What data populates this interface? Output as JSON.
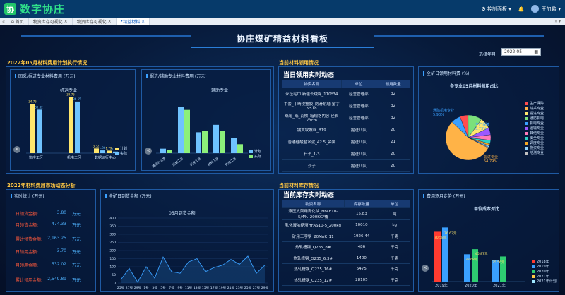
{
  "app": {
    "title": "数字协庄",
    "logo_glyph": "协",
    "control_panel": "控制面板",
    "user": "王加鹏"
  },
  "tabs": {
    "home": "首页",
    "items": [
      "物资库存可视化",
      "物资库存可视化",
      "精益材料"
    ]
  },
  "dashboard": {
    "title": "协庄煤矿精益材料看板",
    "month_label": "选择年月",
    "month_value": "2022-05",
    "sec_monthly": "2022年05月材料费用计划执行情况",
    "sec_dynamic": "2022年材料费用市场动态分析",
    "sec_today": "当前材料领用情况",
    "sec_stock": "当前材料库存情况"
  },
  "panel_mining": {
    "title": "回采/掘进专业材料费用 (万元)",
    "subtitle": "机运专业",
    "legend": [
      "计划",
      "实际"
    ],
    "categories": [
      "协庄工区",
      "机电工区",
      "数据运行中心"
    ],
    "plan": [
      34.76,
      39.76,
      3.32,
      1.79
    ],
    "actual": [
      30.82,
      36.55,
      1.96,
      1.11
    ],
    "nav_prev": "<"
  },
  "panel_aux": {
    "title": "掘进/辅助专业材料费用 (万元)",
    "subtitle": "辅助专业",
    "legend": [
      "计划",
      "实际"
    ],
    "categories": [
      "通风办公室",
      "运输工区",
      "机电工区",
      "材料工区",
      "供应工区"
    ],
    "nav_prev": "<"
  },
  "today_usage": {
    "title": "当日领用实时动态",
    "headers": [
      "物资名称",
      "单位",
      "领用数量"
    ],
    "rows": [
      [
        "永莅毛巾 新疆长绒棉_110*34",
        "经营管理部",
        "32"
      ],
      [
        "手套_丁晴浸塑胶_防滑耐磨 星字N518",
        "经营管理部",
        "32"
      ],
      [
        "纸箱_纸_瓦楞_箱规格内容 径长23cm",
        "经营管理部",
        "32"
      ],
      [
        "镀黄坎螺丝_B19",
        "掘进八队",
        "20"
      ],
      [
        "普通硅酸盐水泥_42.5_袋装",
        "掘进八队",
        "21"
      ],
      [
        "石子_1-3",
        "掘进八队",
        "20"
      ],
      [
        "沙子",
        "掘进八队",
        "20"
      ]
    ]
  },
  "pie_panel": {
    "title": "全矿日领用材料费 (%)",
    "chart_title": "各专业05月材料领用占比",
    "labels": [
      "通防机电专业",
      "生产保障",
      "其他",
      "掘进专业"
    ],
    "pct_labels": [
      "5.90%",
      "6.73%",
      "",
      "54.79%"
    ],
    "legend": [
      "生产保障",
      "综采专业",
      "掘进专业",
      "通防机电",
      "机电专业",
      "运输专业",
      "其他专业",
      "安全专业",
      "调度专业",
      "物资专业",
      "地测专业"
    ]
  },
  "summary": {
    "title": "实时统计 (万元)",
    "rows": [
      {
        "k": "日领货金额:",
        "v": "3.80",
        "u": "万元"
      },
      {
        "k": "月领货金额:",
        "v": "474.33",
        "u": "万元"
      },
      {
        "k": "累计领货金额:",
        "v": "2,163.25",
        "u": "万元"
      },
      {
        "k": "日领用金额:",
        "v": "3.70",
        "u": "万元"
      },
      {
        "k": "月领用金额:",
        "v": "532.02",
        "u": "万元"
      },
      {
        "k": "累计领用金额:",
        "v": "2,549.89",
        "u": "万元"
      }
    ]
  },
  "chart_data": [
    {
      "type": "line",
      "title": "05月到货金额",
      "panel_title": "全矿日到货金额 (万元)",
      "x": [
        "25号",
        "27号",
        "29号",
        "1号",
        "3号",
        "5号",
        "7号",
        "9号",
        "11号",
        "13号",
        "15号",
        "17号",
        "19号",
        "21号",
        "23号",
        "25号",
        "27号",
        "29号"
      ],
      "values": [
        20,
        90,
        5,
        100,
        30,
        160,
        70,
        60,
        130,
        150,
        70,
        95,
        110,
        145,
        115,
        165,
        60,
        110
      ],
      "ylim": [
        0,
        400
      ],
      "yticks": [
        0,
        50,
        100,
        150,
        200,
        250,
        300,
        350,
        400
      ]
    },
    {
      "type": "bar",
      "title": "单位成本对比",
      "panel_title": "费用逐月走势 (万元)",
      "categories": [
        "2019年",
        "2020年",
        "2021年"
      ],
      "series": [
        {
          "name": "2018年",
          "values": [
            70.58,
            0,
            0
          ],
          "color": "#ff3b30"
        },
        {
          "name": "2019年",
          "values": [
            76.63,
            38.68,
            30.5
          ],
          "color": "#3aa0ff"
        },
        {
          "name": "2020年",
          "values": [
            0,
            45.87,
            35.56
          ],
          "color": "#2ecc71"
        },
        {
          "name": "2021年",
          "values": [
            0,
            0,
            0
          ],
          "color": "#ffc845"
        },
        {
          "name": "2021年计划",
          "values": [
            0,
            0,
            0
          ],
          "color": "#a0e7ff"
        }
      ],
      "labels": [
        "70.58元",
        "76.63元",
        "38.68元",
        "45.87元",
        "35.56元"
      ]
    }
  ],
  "stock": {
    "title": "当前库存实时动态",
    "headers": [
      "物资名称",
      "库存数量",
      "单位"
    ],
    "rows": [
      [
        "液压支架用乳化油_HFAE10-5/4%_200KG/桶",
        "15.83",
        "吨"
      ],
      [
        "乳化液浓缩液HFAS10-5_200kg",
        "10010",
        "kg"
      ],
      [
        "矿用工字钢_20MnK_11",
        "1926.44",
        "千克"
      ],
      [
        "热轧槽钢_Q235_8#",
        "486",
        "千克"
      ],
      [
        "热轧槽钢_Q235_6.3#",
        "1400",
        "千克"
      ],
      [
        "热轧槽钢_Q235_16#",
        "5475",
        "千克"
      ],
      [
        "热轧槽钢_Q235_12#",
        "28105",
        "千克"
      ]
    ]
  }
}
